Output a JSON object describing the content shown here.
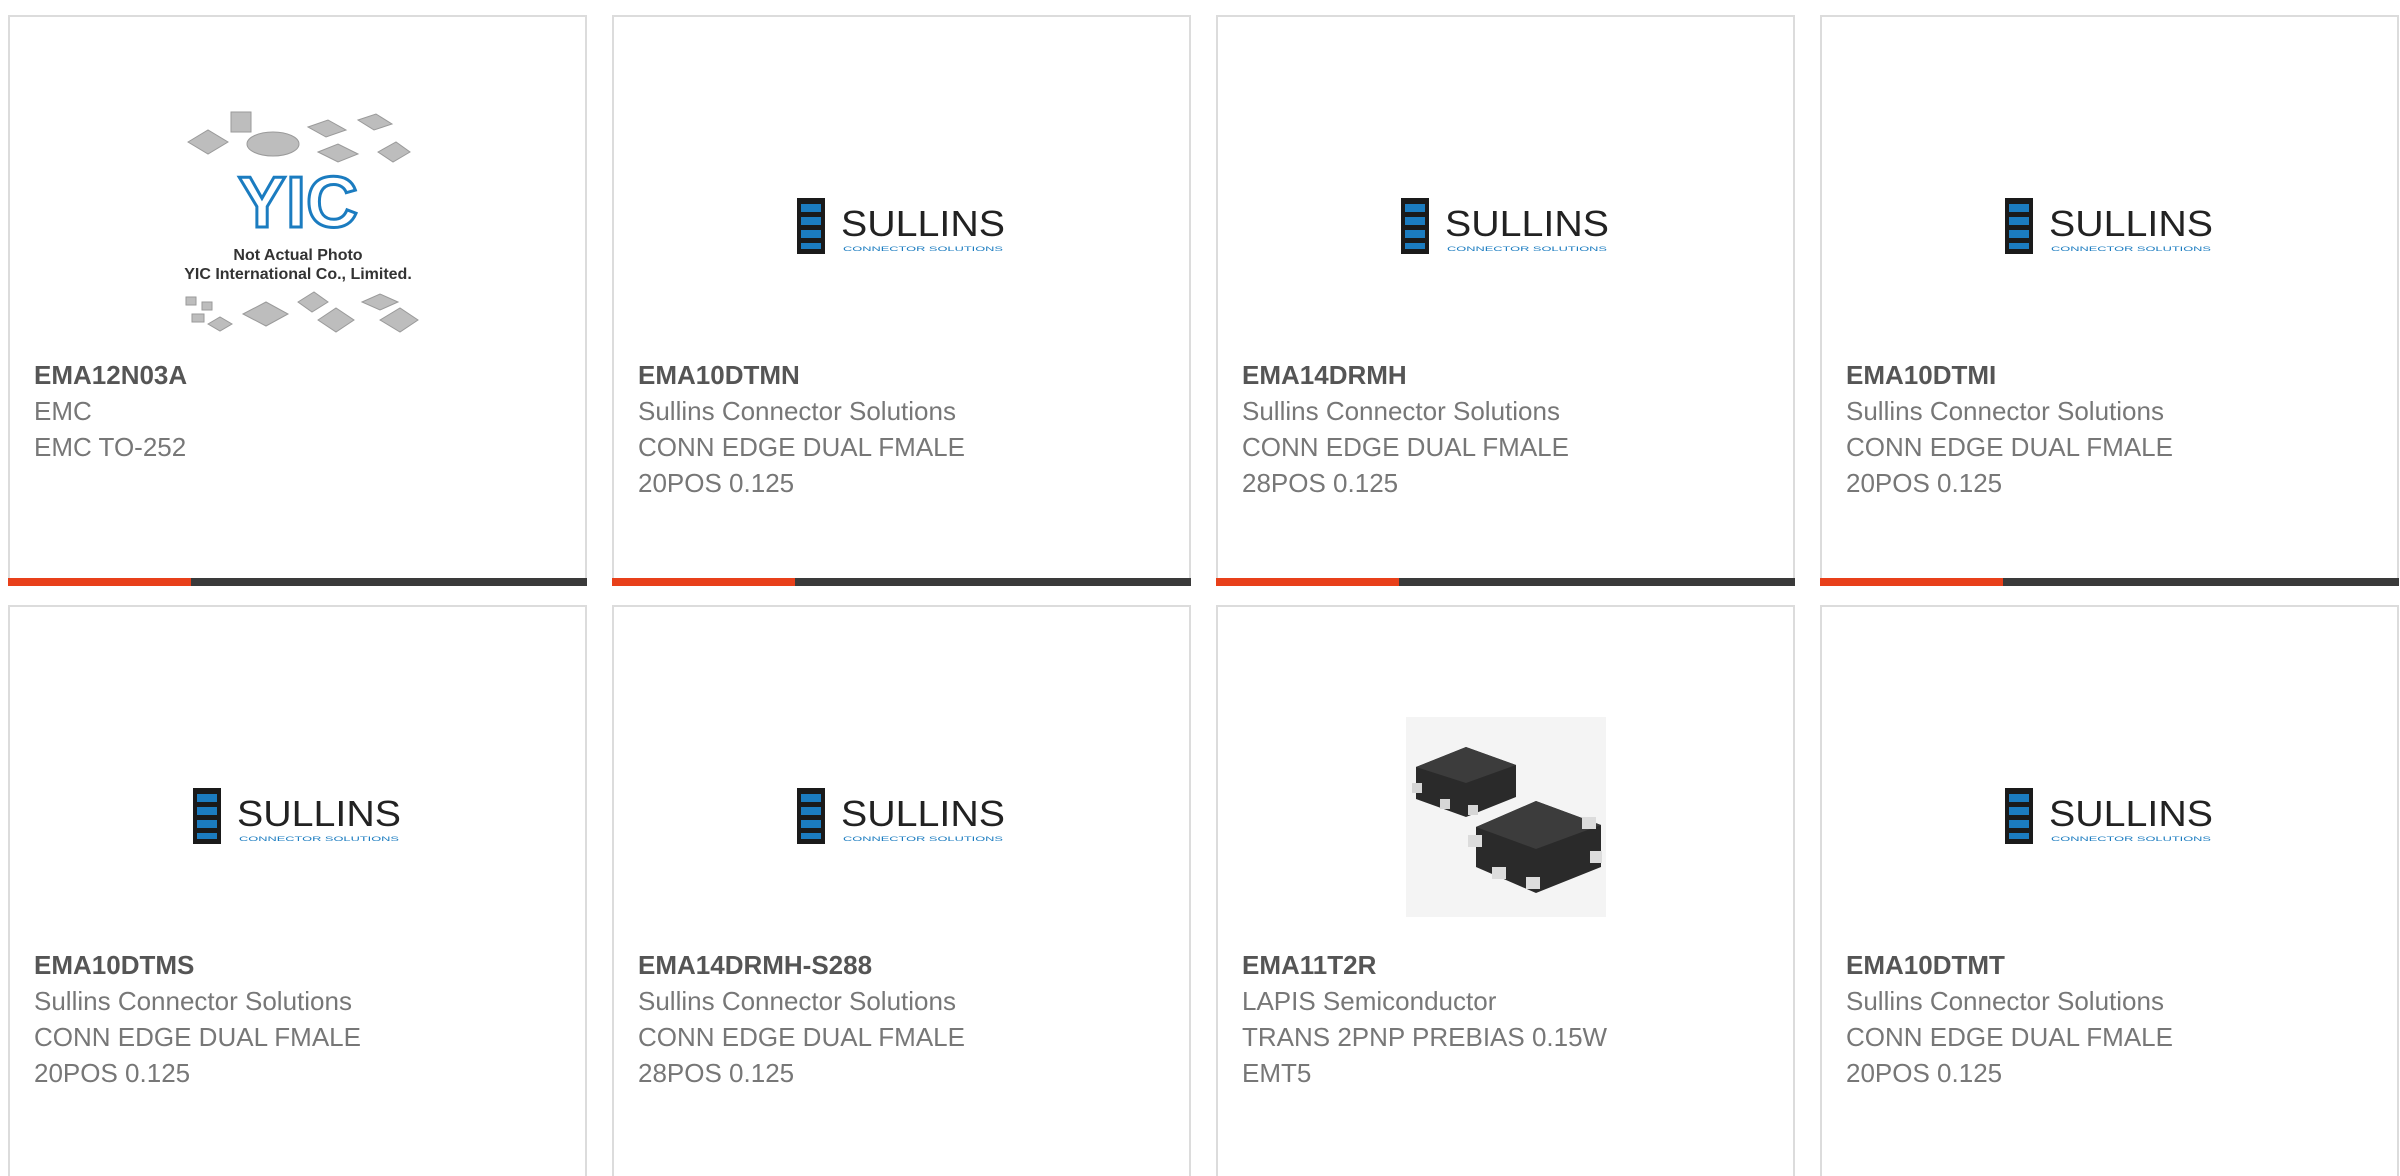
{
  "colors": {
    "accent": "#e8401a",
    "bar": "#3a3a3a",
    "border": "#dcdcdc",
    "sullins_blue": "#1b7cc0"
  },
  "placeholder_logo": {
    "brand": "YIC",
    "line1": "Not Actual Photo",
    "line2": "YIC International Co., Limited."
  },
  "sullins_logo": {
    "word": "SULLINS",
    "tagline": "CONNECTOR SOLUTIONS"
  },
  "products": [
    {
      "part": "EMA12N03A",
      "manufacturer": "EMC",
      "desc1": "EMC TO-252",
      "desc2": "",
      "image": "yic-placeholder"
    },
    {
      "part": "EMA10DTMN",
      "manufacturer": "Sullins Connector Solutions",
      "desc1": "CONN EDGE DUAL FMALE",
      "desc2": "20POS 0.125",
      "image": "sullins-logo"
    },
    {
      "part": "EMA14DRMH",
      "manufacturer": "Sullins Connector Solutions",
      "desc1": "CONN EDGE DUAL FMALE",
      "desc2": "28POS 0.125",
      "image": "sullins-logo"
    },
    {
      "part": "EMA10DTMI",
      "manufacturer": "Sullins Connector Solutions",
      "desc1": "CONN EDGE DUAL FMALE",
      "desc2": "20POS 0.125",
      "image": "sullins-logo"
    },
    {
      "part": "EMA10DTMS",
      "manufacturer": "Sullins Connector Solutions",
      "desc1": "CONN EDGE DUAL FMALE",
      "desc2": "20POS 0.125",
      "image": "sullins-logo"
    },
    {
      "part": "EMA14DRMH-S288",
      "manufacturer": "Sullins Connector Solutions",
      "desc1": "CONN EDGE DUAL FMALE",
      "desc2": "28POS 0.125",
      "image": "sullins-logo"
    },
    {
      "part": "EMA11T2R",
      "manufacturer": "LAPIS Semiconductor",
      "desc1": "TRANS 2PNP PREBIAS 0.15W",
      "desc2": "EMT5",
      "image": "chip-photo"
    },
    {
      "part": "EMA10DTMT",
      "manufacturer": "Sullins Connector Solutions",
      "desc1": "CONN EDGE DUAL FMALE",
      "desc2": "20POS 0.125",
      "image": "sullins-logo"
    }
  ]
}
